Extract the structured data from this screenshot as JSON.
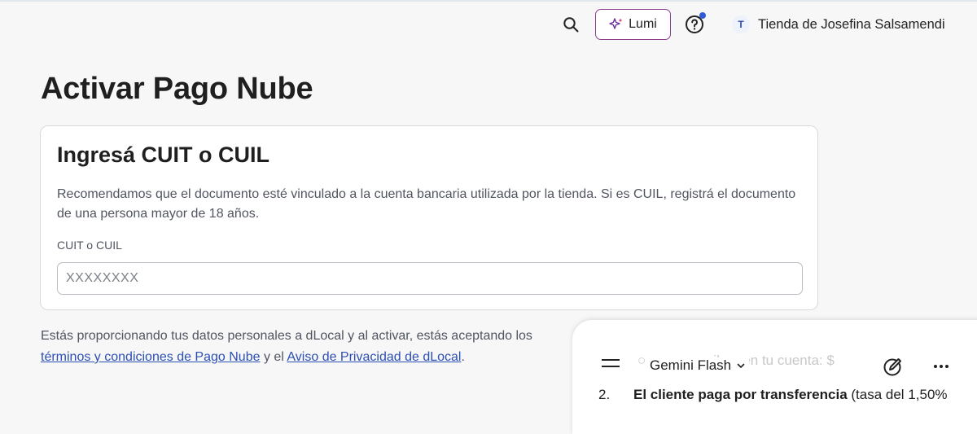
{
  "header": {
    "lumi_label": "Lumi",
    "store_initial": "T",
    "store_name": "Tienda de Josefina Salsamendi",
    "colors": {
      "lumi_border": "#8b3f8b",
      "notification_dot": "#2f5bd8"
    }
  },
  "page": {
    "title": "Activar Pago Nube"
  },
  "card": {
    "title": "Ingresá CUIT o CUIL",
    "description": "Recomendamos que el documento esté vinculado a la cuenta bancaria utilizada por la tienda. Si es CUIL, registrá el documento de una persona mayor de 18 años.",
    "field_label": "CUIT o CUIL",
    "field_placeholder": "XXXXXXXX",
    "field_value": ""
  },
  "legal": {
    "text_before": "Estás proporcionando tus datos personales a dLocal y al activar, estás aceptando los ",
    "link_terms": "términos y condiciones de Pago Nube",
    "text_middle": " y el ",
    "link_privacy": "Aviso de Privacidad de dLocal",
    "text_after": "."
  },
  "gemini": {
    "ghost_text": "○ … que recibes en tu cuenta: $",
    "model_label": "Gemini Flash",
    "list_number": "2.",
    "list_bold": "El cliente paga por transferencia",
    "list_rest": " (tasa del 1,50%"
  }
}
